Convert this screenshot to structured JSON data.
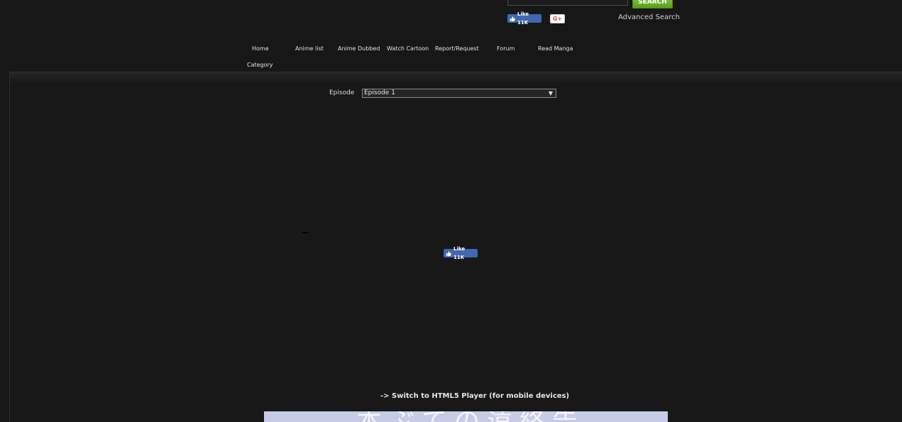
{
  "header": {
    "search": {
      "button_label": "SEARCH",
      "value": ""
    },
    "social": {
      "fb_like_label": "Like 11K",
      "gplus_label": "G+"
    },
    "advanced_search": "Advanced Search"
  },
  "nav": {
    "home": "Home",
    "anime_list": "Anime list",
    "anime_dubbed": "Anime Dubbed",
    "watch_cartoon": "Watch Cartoon",
    "report_request": "Report/Request",
    "forum": "Forum",
    "read_manga": "Read Manga",
    "category": "Category"
  },
  "episode": {
    "label": "Episode",
    "selected": "Episode 1"
  },
  "player": {
    "fb_like_label": "Like 11K"
  },
  "html5_switch": "-> Switch to HTML5 Player (for mobile devices)",
  "ad_banner": {
    "text": "本ぶての遠終告"
  },
  "colors": {
    "background": "#171717",
    "search_button": "#6ab42a",
    "facebook_blue": "#4267b2",
    "gplus_red": "#dd4b39",
    "ad_banner_bg": "#c7cbe6"
  },
  "icons": {
    "facebook_like": "thumbs-up-icon",
    "select_arrow": "triangle-down-icon"
  }
}
